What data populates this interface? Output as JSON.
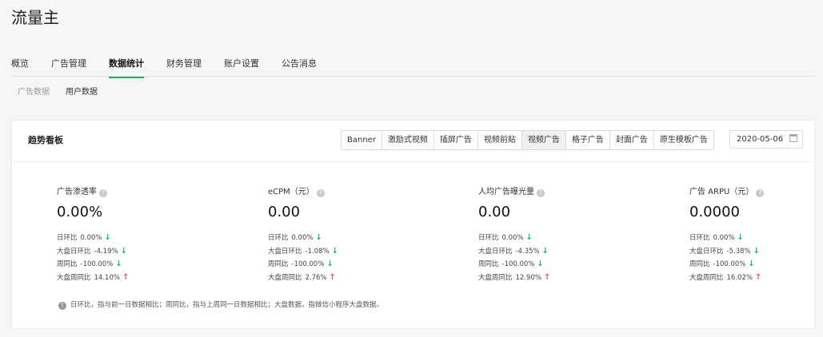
{
  "app": {
    "title": "流量主"
  },
  "main_tabs": [
    {
      "label": "概览",
      "active": false
    },
    {
      "label": "广告管理",
      "active": false
    },
    {
      "label": "数据统计",
      "active": true
    },
    {
      "label": "财务管理",
      "active": false
    },
    {
      "label": "账户设置",
      "active": false
    },
    {
      "label": "公告消息",
      "active": false
    }
  ],
  "sub_tabs": [
    {
      "label": "广告数据",
      "active": false
    },
    {
      "label": "用户数据",
      "active": true
    }
  ],
  "card": {
    "title": "趋势看板",
    "ad_types": [
      "Banner",
      "激励式视频",
      "插屏广告",
      "视频前贴",
      "视频广告",
      "格子广告",
      "封面广告",
      "原生模板广告"
    ],
    "selected_ad_type": "视频广告",
    "date": "2020-05-06",
    "help_glyph": "?",
    "metrics": [
      {
        "title": "广告渗透率",
        "value": "0.00%",
        "rows": [
          {
            "label": "日环比",
            "value": "0.00%",
            "trend": "down"
          },
          {
            "label": "大盘日环比",
            "value": "-4.19%",
            "trend": "down"
          },
          {
            "label": "周同比",
            "value": "-100.00%",
            "trend": "down"
          },
          {
            "label": "大盘周同比",
            "value": "14.10%",
            "trend": "up"
          }
        ]
      },
      {
        "title": "eCPM（元）",
        "value": "0.00",
        "rows": [
          {
            "label": "日环比",
            "value": "0.00%",
            "trend": "down"
          },
          {
            "label": "大盘日环比",
            "value": "-1.08%",
            "trend": "down"
          },
          {
            "label": "周同比",
            "value": "-100.00%",
            "trend": "down"
          },
          {
            "label": "大盘周同比",
            "value": "2.76%",
            "trend": "up"
          }
        ]
      },
      {
        "title": "人均广告曝光量",
        "value": "0.00",
        "rows": [
          {
            "label": "日环比",
            "value": "0.00%",
            "trend": "down"
          },
          {
            "label": "大盘日环比",
            "value": "-4.35%",
            "trend": "down"
          },
          {
            "label": "周同比",
            "value": "-100.00%",
            "trend": "down"
          },
          {
            "label": "大盘周同比",
            "value": "12.90%",
            "trend": "up"
          }
        ]
      },
      {
        "title": "广告 ARPU（元）",
        "value": "0.0000",
        "rows": [
          {
            "label": "日环比",
            "value": "0.00%",
            "trend": "down"
          },
          {
            "label": "大盘日环比",
            "value": "-5.38%",
            "trend": "down"
          },
          {
            "label": "周同比",
            "value": "-100.00%",
            "trend": "down"
          },
          {
            "label": "大盘周同比",
            "value": "16.02%",
            "trend": "up"
          }
        ]
      }
    ],
    "note": "日环比，指与前一日数据相比；周同比，指与上周同一日数据相比；大盘数据，指微信小程序大盘数据。",
    "note_glyph": "!"
  },
  "colors": {
    "accent": "#07c160",
    "up": "#fa5151",
    "down": "#07c160"
  }
}
